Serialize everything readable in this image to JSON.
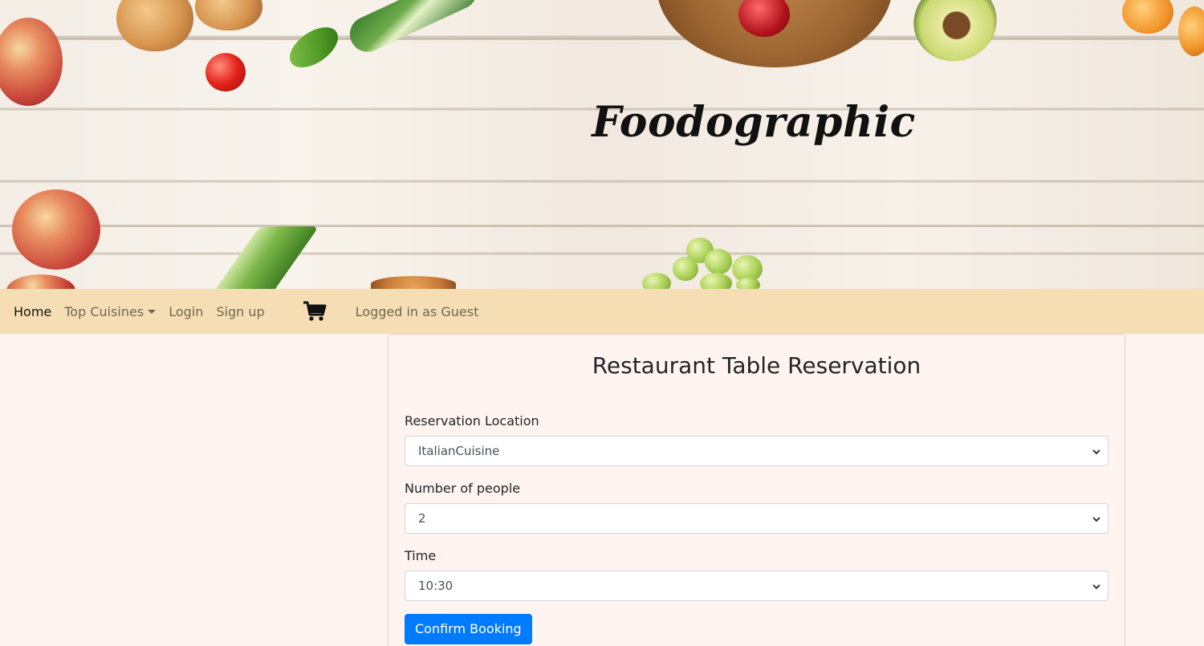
{
  "hero": {
    "title": "Foodographic"
  },
  "navbar": {
    "home_label": "Home",
    "top_cuisines_label": "Top Cuisines",
    "login_label": "Login",
    "signup_label": "Sign up",
    "cart_icon": "shopping-cart-icon",
    "logged_in_text": "Logged in as Guest"
  },
  "reservation": {
    "title": "Restaurant Table Reservation",
    "location": {
      "label": "Reservation Location",
      "value": "ItalianCuisine"
    },
    "people": {
      "label": "Number of people",
      "value": "2"
    },
    "time": {
      "label": "Time",
      "value": "10:30"
    },
    "confirm_label": "Confirm Booking"
  },
  "colors": {
    "navbar_bg": "#f5deb3",
    "page_bg": "#fff4ef",
    "primary": "#007bff"
  }
}
